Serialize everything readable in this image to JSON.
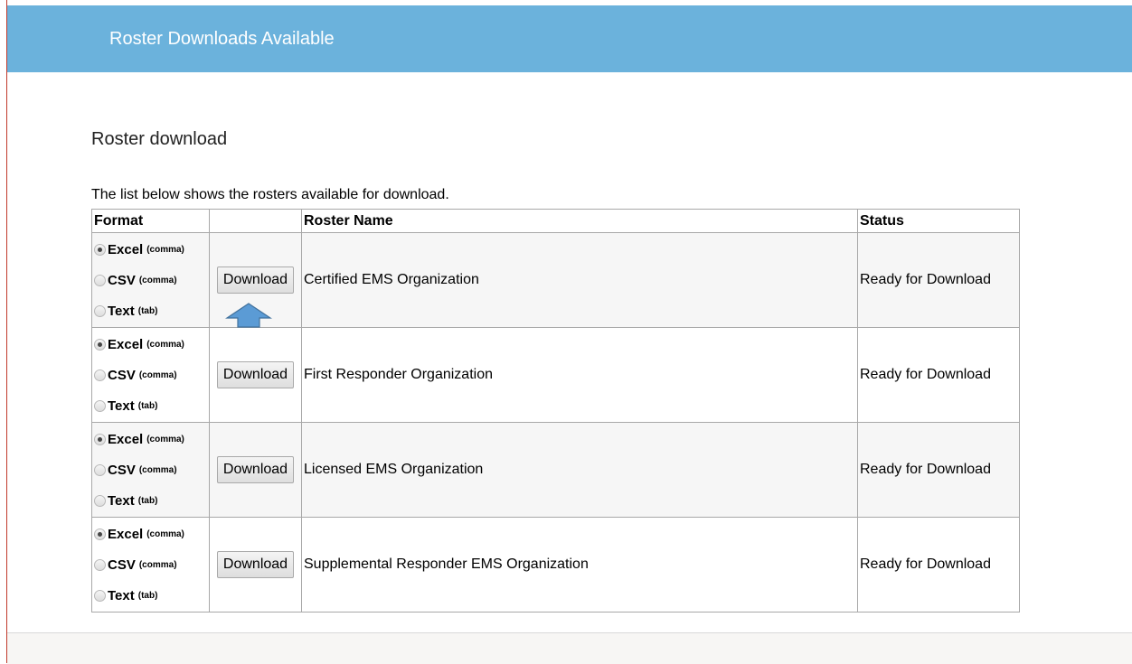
{
  "header": {
    "title": "Roster Downloads Available"
  },
  "page": {
    "section_title": "Roster download",
    "intro": "The list below shows the rosters available for download."
  },
  "table": {
    "columns": [
      "Format",
      "",
      "Roster Name",
      "Status"
    ],
    "format_options": [
      {
        "label": "Excel",
        "note": "(comma)"
      },
      {
        "label": "CSV",
        "note": "(comma)"
      },
      {
        "label": "Text",
        "note": "(tab)"
      }
    ],
    "download_label": "Download",
    "rows": [
      {
        "name": "Certified EMS Organization",
        "status": "Ready for Download",
        "selected_format": "Excel"
      },
      {
        "name": "First Responder Organization",
        "status": "Ready for Download",
        "selected_format": "Excel"
      },
      {
        "name": "Licensed EMS Organization",
        "status": "Ready for Download",
        "selected_format": "Excel"
      },
      {
        "name": "Supplemental Responder EMS Organization",
        "status": "Ready for Download",
        "selected_format": "Excel"
      }
    ]
  },
  "colors": {
    "header_bg": "#6bb2dc",
    "annotation_arrow": "#5b9bd5",
    "row_alt_bg": "#f6f6f6"
  },
  "annotation": {
    "icon": "up-arrow-icon"
  }
}
